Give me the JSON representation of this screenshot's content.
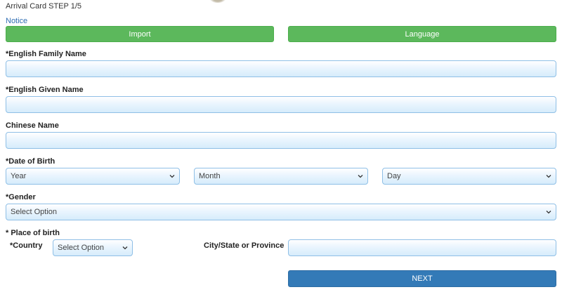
{
  "header": {
    "title": "Arrival Card STEP 1/5",
    "notice_link": "Notice"
  },
  "actions": {
    "import_label": "Import",
    "language_label": "Language",
    "next_label": "NEXT"
  },
  "form": {
    "family_name_label": "*English Family Name",
    "given_name_label": "*English Given Name",
    "chinese_name_label": "Chinese Name",
    "dob_label": "*Date of Birth",
    "dob_year": "Year",
    "dob_month": "Month",
    "dob_day": "Day",
    "gender_label": "*Gender",
    "gender_value": "Select Option",
    "place_of_birth_label": "* Place of birth",
    "country_label": "*Country",
    "country_value": "Select Option",
    "city_label": "City/State or Province"
  },
  "colors": {
    "green_button": "#5cb85c",
    "blue_button": "#337ab7",
    "input_border": "#8fbfe6",
    "link": "#2f6db3"
  }
}
